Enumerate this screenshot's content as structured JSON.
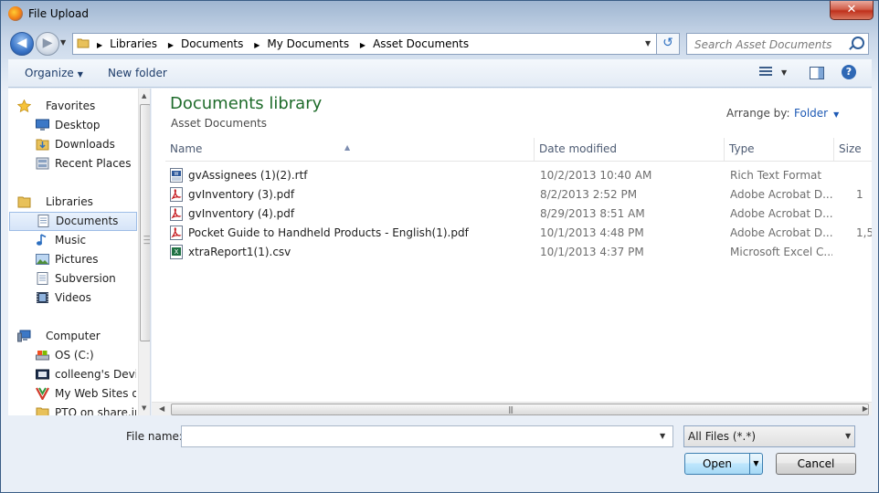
{
  "window": {
    "title": "File Upload",
    "close_label": "✕"
  },
  "nav": {
    "breadcrumbs": [
      "Libraries",
      "Documents",
      "My Documents",
      "Asset Documents"
    ],
    "search_placeholder": "Search Asset Documents"
  },
  "commands": {
    "organize": "Organize",
    "new_folder": "New folder",
    "help": "?"
  },
  "sidebar": {
    "items": [
      {
        "label": "Favorites",
        "icon": "star-icon",
        "group": true
      },
      {
        "label": "Desktop",
        "icon": "desktop-icon"
      },
      {
        "label": "Downloads",
        "icon": "downloads-folder-icon"
      },
      {
        "label": "Recent Places",
        "icon": "recent-places-icon"
      },
      {
        "label": "Libraries",
        "icon": "libraries-icon",
        "group": true
      },
      {
        "label": "Documents",
        "icon": "documents-icon",
        "selected": true
      },
      {
        "label": "Music",
        "icon": "music-icon"
      },
      {
        "label": "Pictures",
        "icon": "pictures-icon"
      },
      {
        "label": "Subversion",
        "icon": "subversion-icon"
      },
      {
        "label": "Videos",
        "icon": "videos-icon"
      },
      {
        "label": "Computer",
        "icon": "computer-icon",
        "group": true
      },
      {
        "label": "OS (C:)",
        "icon": "drive-icon"
      },
      {
        "label": "colleeng's Device",
        "icon": "device-icon"
      },
      {
        "label": "My Web Sites on",
        "icon": "web-sites-icon"
      },
      {
        "label": "PTO on share.int",
        "icon": "network-folder-icon"
      }
    ]
  },
  "library": {
    "title": "Documents library",
    "subtitle": "Asset Documents",
    "arrange_label": "Arrange by:",
    "arrange_value": "Folder"
  },
  "table": {
    "columns": [
      "Name",
      "Date modified",
      "Type",
      "Size"
    ],
    "rows": [
      {
        "name": "gvAssignees (1)(2).rtf",
        "date": "10/2/2013 10:40 AM",
        "type": "Rich Text Format",
        "size": "",
        "icon": "rtf-file-icon"
      },
      {
        "name": "gvInventory (3).pdf",
        "date": "8/2/2013 2:52 PM",
        "type": "Adobe Acrobat D...",
        "size": "1",
        "icon": "pdf-file-icon"
      },
      {
        "name": "gvInventory (4).pdf",
        "date": "8/29/2013 8:51 AM",
        "type": "Adobe Acrobat D...",
        "size": "",
        "icon": "pdf-file-icon"
      },
      {
        "name": "Pocket Guide to Handheld Products - English(1).pdf",
        "date": "10/1/2013 4:48 PM",
        "type": "Adobe Acrobat D...",
        "size": "1,5",
        "icon": "pdf-file-icon"
      },
      {
        "name": "xtraReport1(1).csv",
        "date": "10/1/2013 4:37 PM",
        "type": "Microsoft Excel C...",
        "size": "",
        "icon": "csv-file-icon"
      }
    ]
  },
  "footer": {
    "file_name_label": "File name:",
    "file_name_value": "",
    "filter_value": "All Files (*.*)",
    "open_label": "Open",
    "cancel_label": "Cancel"
  }
}
